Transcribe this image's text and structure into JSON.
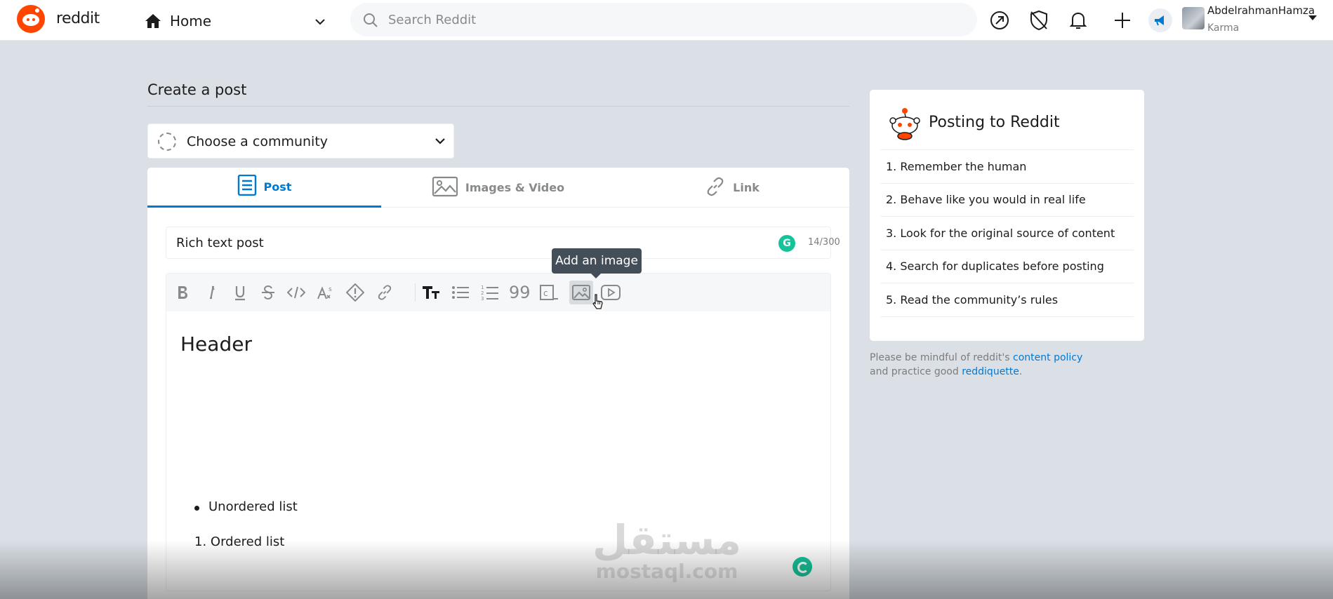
{
  "header": {
    "wordmark": "reddit",
    "home_label": "Home",
    "search_placeholder": "Search Reddit",
    "user_name": "AbdelrahmanHamza",
    "user_karma": "Karma"
  },
  "main": {
    "title": "Create a post",
    "community_label": "Choose a community",
    "tabs": [
      {
        "label": "Post",
        "icon": "document-icon",
        "active": true
      },
      {
        "label": "Images & Video",
        "icon": "image-icon",
        "active": false
      },
      {
        "label": "Link",
        "icon": "link-icon",
        "active": false
      }
    ],
    "title_field_value": "Rich text post",
    "title_counter": "14/300",
    "tooltip": "Add an image",
    "editor": {
      "header_text": "Header",
      "unordered_item": "Unordered list",
      "ordered_item": "1. Ordered list"
    }
  },
  "sidebar": {
    "title": "Posting to Reddit",
    "rules": [
      "1. Remember the human",
      "2. Behave like you would in real life",
      "3. Look for the original source of content",
      "4. Search for duplicates before posting",
      "5. Read the community’s rules"
    ],
    "policy_prefix": "Please be mindful of reddit's ",
    "policy_link": "content policy",
    "policy_middle": "and practice good ",
    "policy_link2": "reddiquette",
    "policy_suffix": "."
  },
  "watermark": {
    "arabic": "مستقل",
    "latin": "mostaql.com"
  },
  "colors": {
    "brand": "#ff4500",
    "accent": "#0079d3",
    "page_bg": "#dae0e6",
    "grammarly": "#15c39a"
  }
}
